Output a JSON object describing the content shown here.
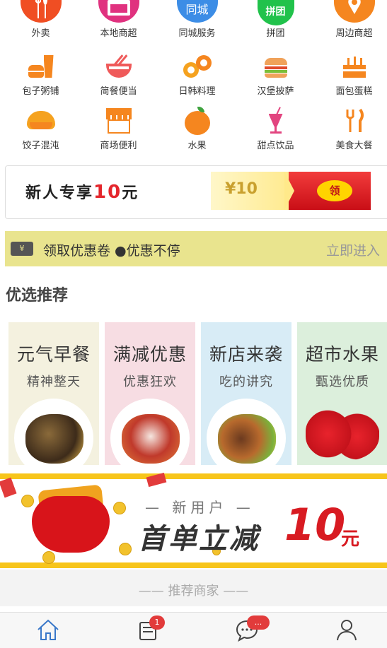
{
  "categories": [
    {
      "label": "外卖",
      "icon": "takeout-icon"
    },
    {
      "label": "本地商超",
      "icon": "supermarket-icon"
    },
    {
      "label": "同城服务",
      "icon": "city-service-icon",
      "icon_text": "同城"
    },
    {
      "label": "拼团",
      "icon": "group-buy-icon",
      "icon_text": "拼团"
    },
    {
      "label": "周边商超",
      "icon": "location-icon"
    },
    {
      "label": "包子粥铺",
      "icon": "bun-icon"
    },
    {
      "label": "简餐便当",
      "icon": "bowl-icon"
    },
    {
      "label": "日韩料理",
      "icon": "sushi-icon"
    },
    {
      "label": "汉堡披萨",
      "icon": "burger-icon"
    },
    {
      "label": "面包蛋糕",
      "icon": "cake-icon"
    },
    {
      "label": "饺子混沌",
      "icon": "dumpling-icon"
    },
    {
      "label": "商场便利",
      "icon": "store-icon"
    },
    {
      "label": "水果",
      "icon": "fruit-icon"
    },
    {
      "label": "甜点饮品",
      "icon": "drink-icon"
    },
    {
      "label": "美食大餐",
      "icon": "cutlery-icon"
    }
  ],
  "banner": {
    "prefix": "新人专享",
    "amount": "10",
    "unit": "元",
    "coupon_value": "¥10",
    "coupon_button": "领"
  },
  "coupon_bar": {
    "ticket_symbol": "¥",
    "text": "领取优惠卷 ●优惠不停",
    "action": "立即进入"
  },
  "section_title": "优选推荐",
  "cards": [
    {
      "title": "元气早餐",
      "subtitle": "精神整天",
      "bg": "#f4f1df"
    },
    {
      "title": "满减优惠",
      "subtitle": "优惠狂欢",
      "bg": "#f7dde3"
    },
    {
      "title": "新店来袭",
      "subtitle": "吃的讲究",
      "bg": "#d8ecf6"
    },
    {
      "title": "超市水果",
      "subtitle": "甄选优质",
      "bg": "#dcefdc"
    }
  ],
  "promo": {
    "sub": "— 新用户 —",
    "main": "首单立减",
    "amount": "10",
    "unit": "元"
  },
  "recommend_title": "—— 推荐商家 ——",
  "tabbar": {
    "orders_badge": "1",
    "messages_badge": "..."
  },
  "colors": {
    "orange": "#f5861f",
    "red": "#e4262c",
    "yellow": "#f7c51b",
    "blue": "#3a78c9"
  }
}
